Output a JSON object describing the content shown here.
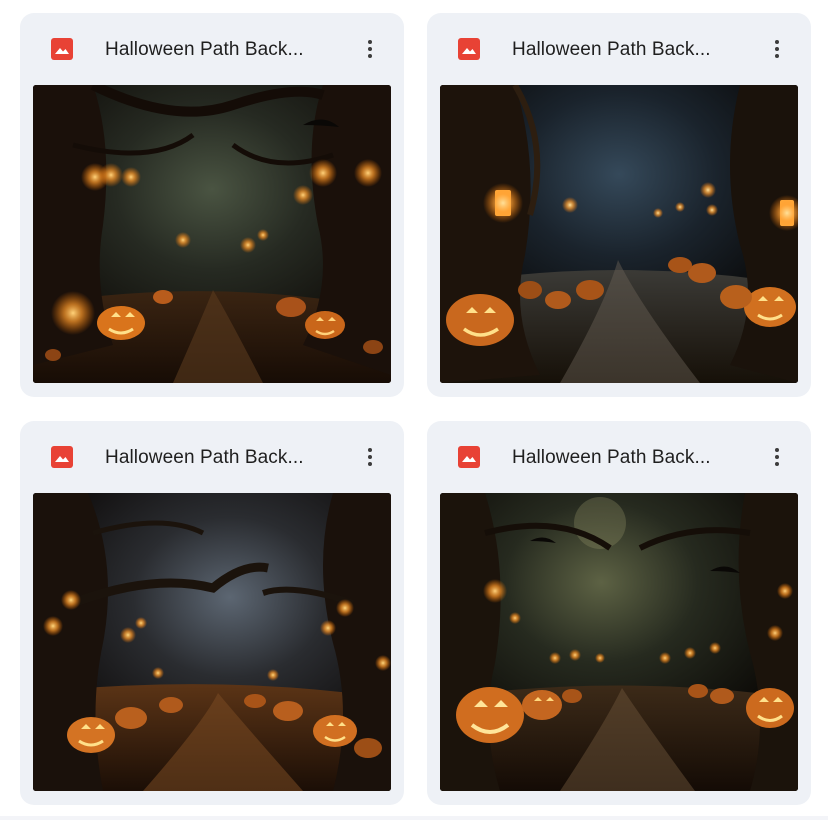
{
  "files": [
    {
      "title": "Halloween Path Back...",
      "file_icon": "image-icon",
      "menu_icon": "more-vert-icon",
      "accent": "#e84235"
    },
    {
      "title": "Halloween Path Back...",
      "file_icon": "image-icon",
      "menu_icon": "more-vert-icon",
      "accent": "#e84235"
    },
    {
      "title": "Halloween Path Back...",
      "file_icon": "image-icon",
      "menu_icon": "more-vert-icon",
      "accent": "#e84235"
    },
    {
      "title": "Halloween Path Back...",
      "file_icon": "image-icon",
      "menu_icon": "more-vert-icon",
      "accent": "#e84235"
    }
  ],
  "colors": {
    "card_background": "#eef1f6",
    "title_text": "#1f1f1f",
    "icon_red": "#e84235"
  }
}
